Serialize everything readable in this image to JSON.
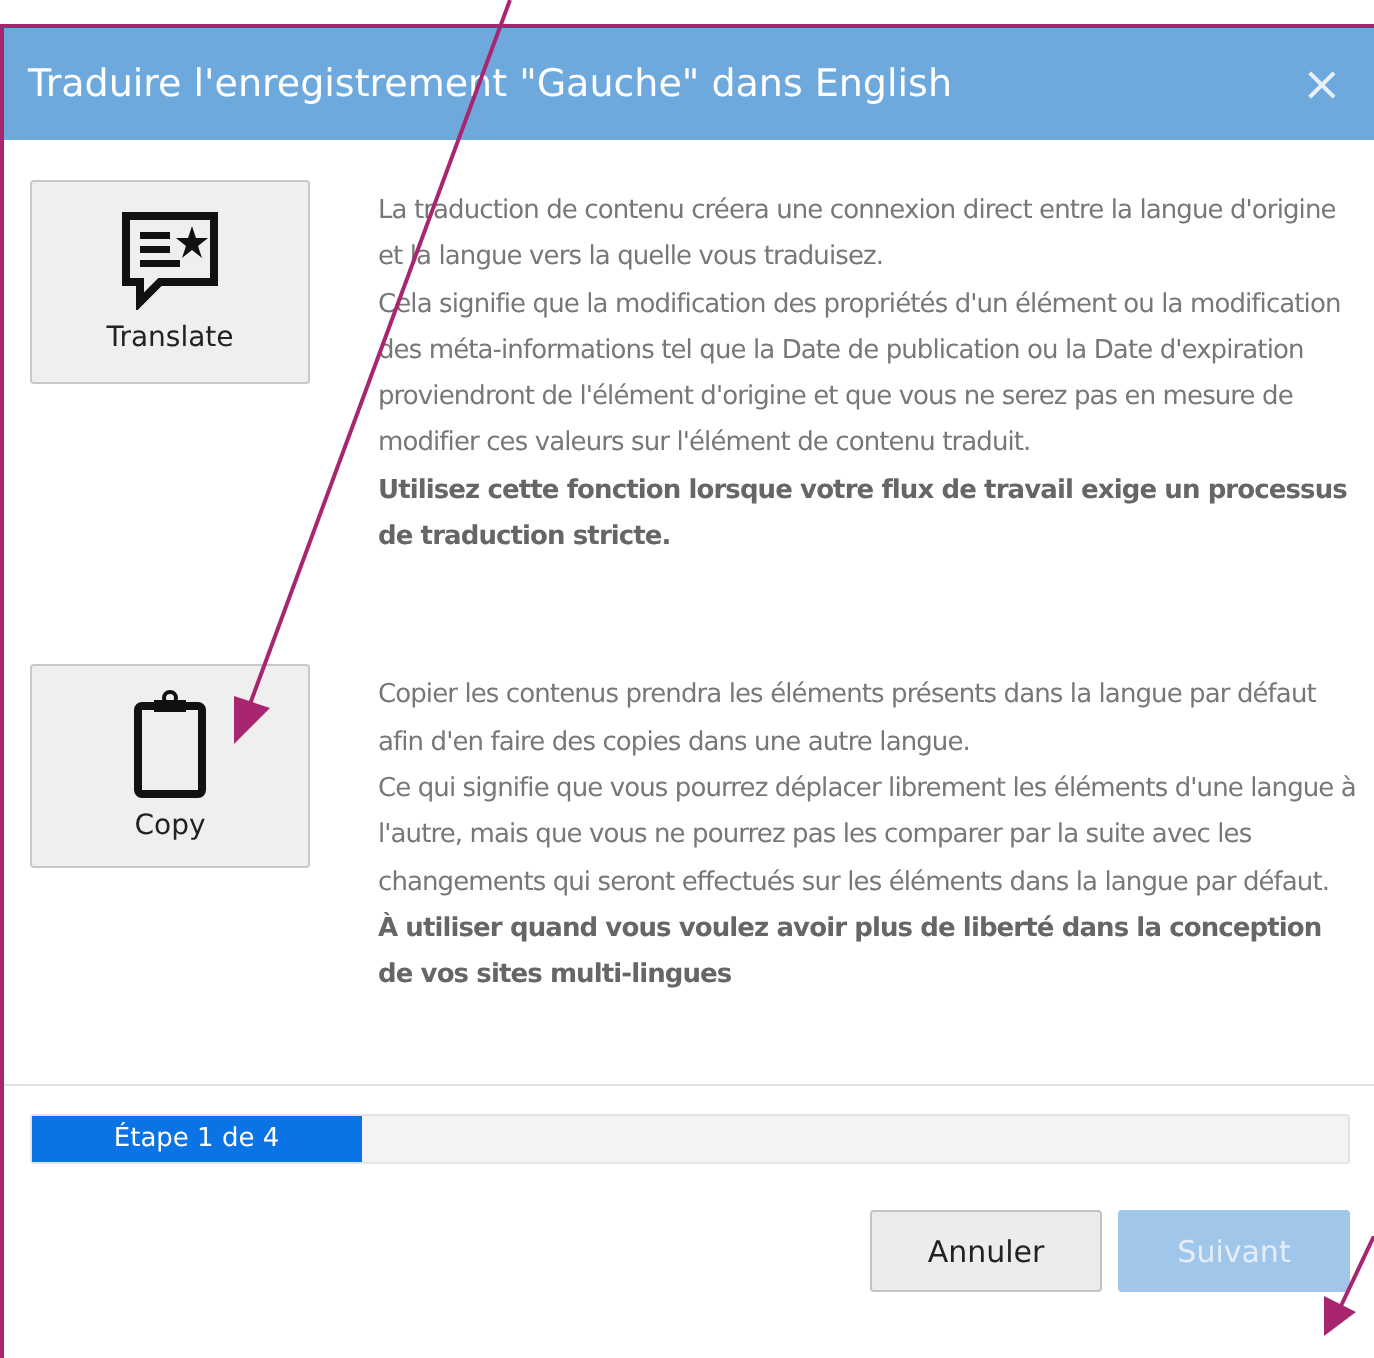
{
  "dialog": {
    "title": "Traduire l'enregistrement \"Gauche\" dans English",
    "close": "×"
  },
  "options": [
    {
      "kind": "translate",
      "label": "Translate",
      "paragraphs": [
        {
          "text": "La traduction de contenu créera une connexion direct entre la langue d'origine et la langue vers la quelle vous traduisez.",
          "emphasis": false
        },
        {
          "text": "Cela signifie que la modification des propriétés d'un élément ou la modification des méta-informations tel que la Date de publication ou la Date d'expiration proviendront de l'élément d'origine et que vous ne serez pas en mesure de modifier ces valeurs sur l'élément de contenu traduit.",
          "emphasis": false
        },
        {
          "text": "Utilisez cette fonction lorsque votre flux de travail exige un processus de traduction stricte.",
          "emphasis": true
        }
      ]
    },
    {
      "kind": "copy",
      "label": "Copy",
      "paragraphs": [
        {
          "text": "Copier les contenus prendra les éléments présents dans la langue par défaut afin d'en faire des copies dans une autre langue.",
          "emphasis": false
        },
        {
          "text": "Ce qui signifie que vous pourrez déplacer librement les éléments d'une langue à l'autre, mais que vous ne pourrez pas les comparer par la suite avec les changements qui seront effectués sur les éléments dans la langue par défaut.",
          "emphasis": false
        },
        {
          "text": "À utiliser quand vous voulez avoir plus de liberté dans la conception de vos sites multi-lingues",
          "emphasis": true
        }
      ]
    }
  ],
  "progress": {
    "label": "Étape 1 de 4",
    "level": 0.25
  },
  "buttons": [
    {
      "label": "Annuler",
      "disabled": false
    },
    {
      "label": "Suivant",
      "disabled": true
    }
  ]
}
